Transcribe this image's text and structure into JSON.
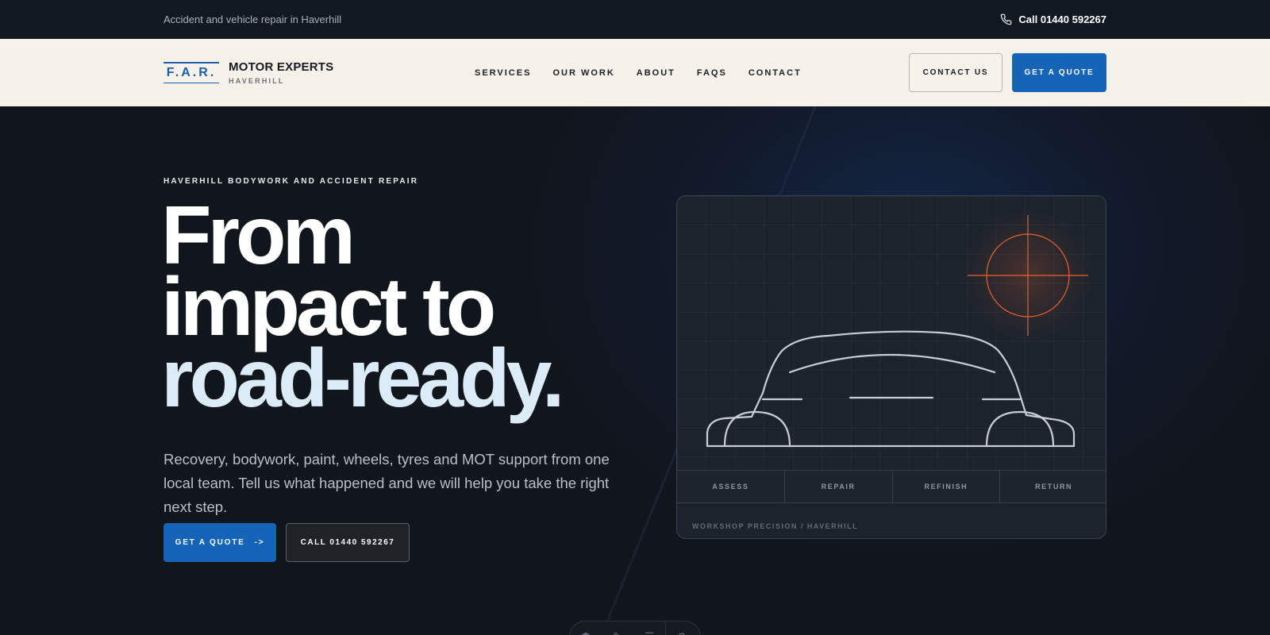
{
  "topbar": {
    "tagline": "Accident and vehicle repair in Haverhill",
    "phone_icon": "phone-icon",
    "phone_label": "Call 01440 592267"
  },
  "nav": {
    "logo_mark": "F.A.R.",
    "logo_name": "MOTOR EXPERTS",
    "logo_location": "HAVERHILL",
    "menu": [
      {
        "label": "SERVICES"
      },
      {
        "label": "OUR WORK"
      },
      {
        "label": "ABOUT"
      },
      {
        "label": "FAQS"
      },
      {
        "label": "CONTACT"
      }
    ],
    "contact_label": "CONTACT US",
    "quote_label": "GET A QUOTE"
  },
  "hero": {
    "kicker": "HAVERHILL BODYWORK AND ACCIDENT REPAIR",
    "headline": [
      "From",
      "impact to",
      "road-ready."
    ],
    "lede": "Recovery, bodywork, paint, wheels, tyres and MOT support from one local team. Tell us what happened and we will help you take the right next step.",
    "quote_button": "GET A QUOTE",
    "quote_arrow": "->",
    "call_button": "CALL 01440 592267"
  },
  "card": {
    "illustration_icon": "car-outline-icon",
    "target_icon": "crosshair-icon",
    "steps": [
      {
        "label": "ASSESS"
      },
      {
        "label": "REPAIR"
      },
      {
        "label": "REFINISH"
      },
      {
        "label": "RETURN"
      }
    ],
    "footer": "WORKSHOP PRECISION / HAVERHILL"
  },
  "colors": {
    "accent_blue": "#1664b7",
    "dark_bg": "#11151c",
    "nav_bg": "#f6f2ea",
    "target_orange": "#e8622c"
  }
}
